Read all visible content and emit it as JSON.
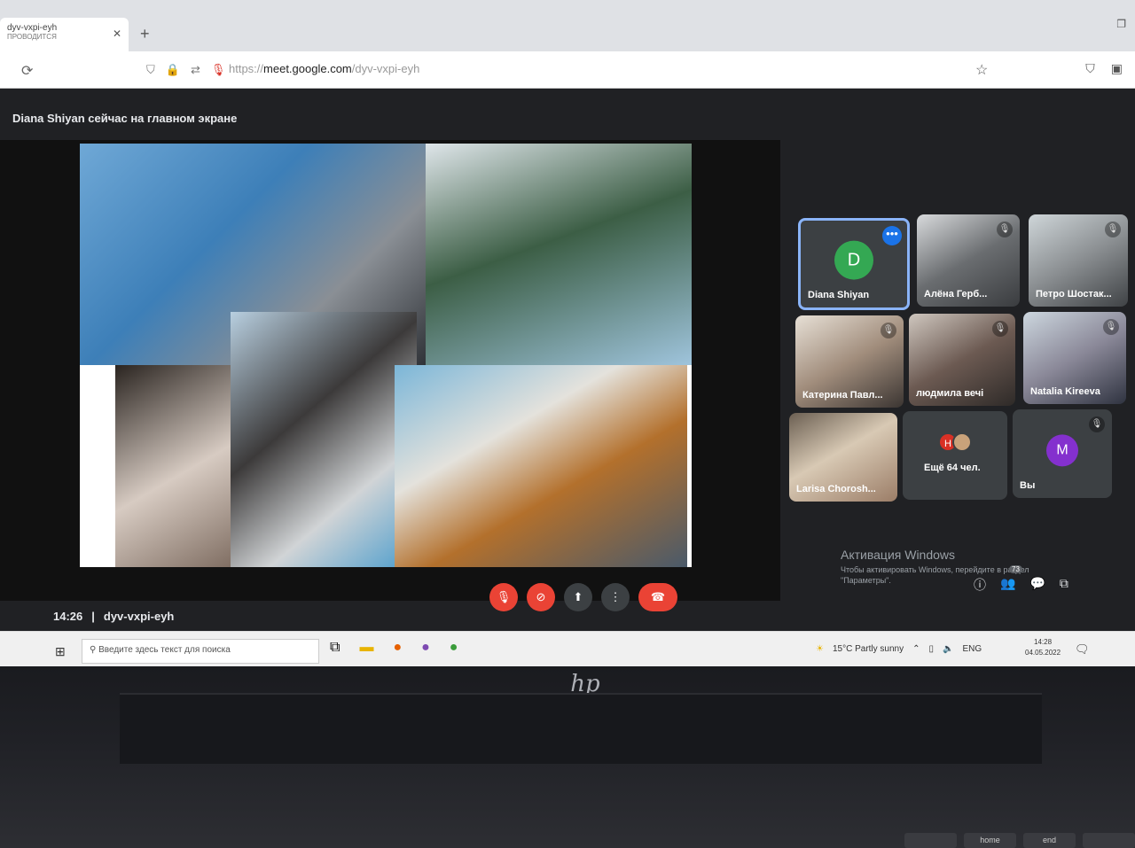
{
  "browser": {
    "tab_title": "dyv-vxpi-eyh",
    "tab_subtitle": "ПРОВОДИТСЯ",
    "url_prefix": "https://",
    "url_host": "meet.google.com",
    "url_path": "/dyv-vxpi-eyh"
  },
  "meet": {
    "presenting_banner": "Diana Shiyan сейчас на главном экране",
    "time": "14:26",
    "meeting_code": "dyv-vxpi-eyh",
    "participants": [
      {
        "name": "Diana Shiyan",
        "initial": "D",
        "avatar_color": "#34a853"
      },
      {
        "name": "Алёна Герб..."
      },
      {
        "name": "Петро Шостак..."
      },
      {
        "name": "Катерина Павл..."
      },
      {
        "name": "людмила вечі"
      },
      {
        "name": "Natalia Kireeva"
      },
      {
        "name": "Larisa Chorosh..."
      }
    ],
    "more_people": {
      "label": "Ещё 64 чел.",
      "initial": "H",
      "initial_color": "#d93025"
    },
    "you": {
      "label": "Вы",
      "initial": "M",
      "avatar_color": "#8430ce"
    },
    "people_count": "73"
  },
  "activation": {
    "title": "Активация Windows",
    "text": "Чтобы активировать Windows, перейдите в раздел \"Параметры\"."
  },
  "taskbar": {
    "search_placeholder": "Введите здесь текст для поиска",
    "weather": "15°C  Partly sunny",
    "lang": "ENG",
    "time": "14:28",
    "date": "04.05.2022"
  },
  "keyboard": {
    "keys": [
      "home",
      "end"
    ]
  }
}
